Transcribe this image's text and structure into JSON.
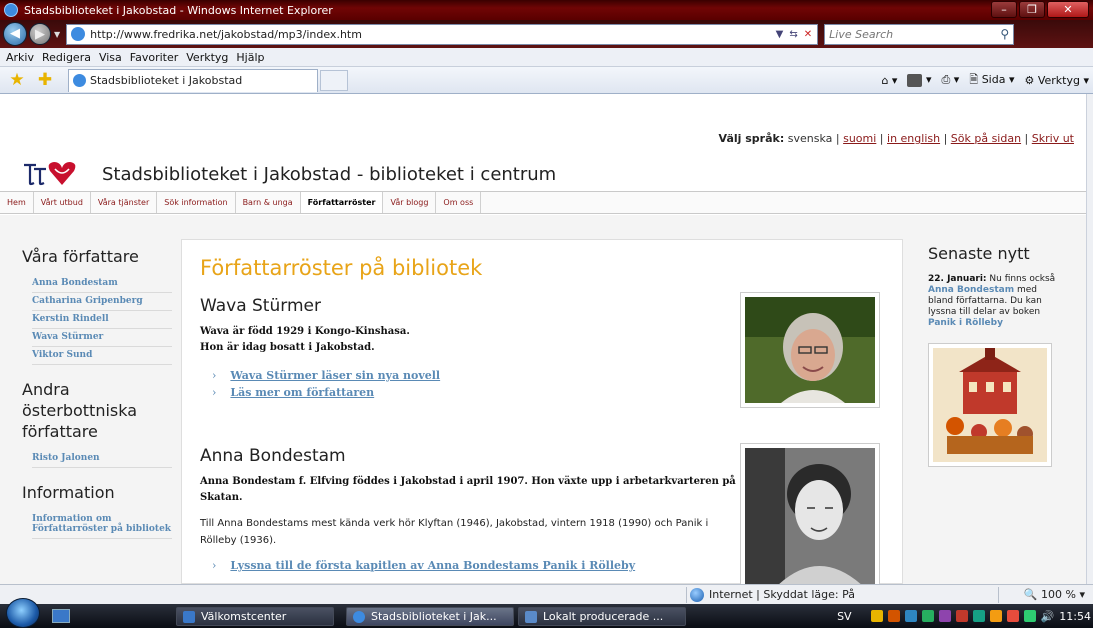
{
  "browser": {
    "window_title": "Stadsbiblioteket i Jakobstad - Windows Internet Explorer",
    "url": "http://www.fredrika.net/jakobstad/mp3/index.htm",
    "search_placeholder": "Live Search",
    "menu": [
      "Arkiv",
      "Redigera",
      "Visa",
      "Favoriter",
      "Verktyg",
      "Hjälp"
    ],
    "tab_title": "Stadsbiblioteket i Jakobstad",
    "cmd_page": "Sida ▾",
    "cmd_tools": "Verktyg ▾",
    "status_zone": "Internet | Skyddat läge: På",
    "zoom": "100 %"
  },
  "site": {
    "lang_label": "Välj språk:",
    "lang_current": "svenska",
    "lang_links": [
      "suomi",
      "in english",
      "Sök på sidan",
      "Skriv ut"
    ],
    "title": "Stadsbiblioteket i Jakobstad - biblioteket i centrum",
    "nav": [
      "Hem",
      "Vårt utbud",
      "Våra tjänster",
      "Sök information",
      "Barn & unga",
      "Författarröster",
      "Vår blogg",
      "Om oss"
    ],
    "nav_active": "Författarröster"
  },
  "left": {
    "heading1": "Våra författare",
    "authors": [
      "Anna Bondestam",
      "Catharina Gripenberg",
      "Kerstin Rindell",
      "Wava Stürmer",
      "Viktor Sund"
    ],
    "heading2": "Andra österbottniska författare",
    "other_authors": [
      "Risto Jalonen"
    ],
    "heading3": "Information",
    "info_links": [
      "Information om Författarröster på bibliotek"
    ]
  },
  "main": {
    "heading": "Författarröster på bibliotek",
    "authors": [
      {
        "name": "Wava Stürmer",
        "intro": "Wava är född 1929 i Kongo-Kinshasa.\nHon är idag bosatt i Jakobstad.",
        "desc": "",
        "links": [
          "Wava Stürmer läser sin nya novell",
          "Läs mer om författaren"
        ]
      },
      {
        "name": "Anna Bondestam",
        "intro": "Anna Bondestam f. Elfving föddes i Jakobstad i april 1907. Hon växte upp i arbetarkvarteren på Skatan.",
        "desc": "Till Anna Bondestams mest kända verk hör Klyftan (1946), Jakobstad, vintern 1918 (1990) och Panik i Rölleby (1936).",
        "links": [
          "Lyssna till de första kapitlen av Anna Bondestams Panik i Rölleby"
        ]
      }
    ]
  },
  "right": {
    "heading": "Senaste nytt",
    "news_date": "22. Januari:",
    "news_text1": "Nu finns också",
    "news_link1": "Anna Bondestam",
    "news_text2": "med bland författarna. Du kan lyssna till delar av boken",
    "news_link2": "Panik i Rölleby"
  },
  "taskbar": {
    "items": [
      "Välkomstcenter",
      "Stadsbiblioteket i Jak...",
      "Lokalt producerade ..."
    ],
    "lang": "SV",
    "clock": "11:54"
  }
}
